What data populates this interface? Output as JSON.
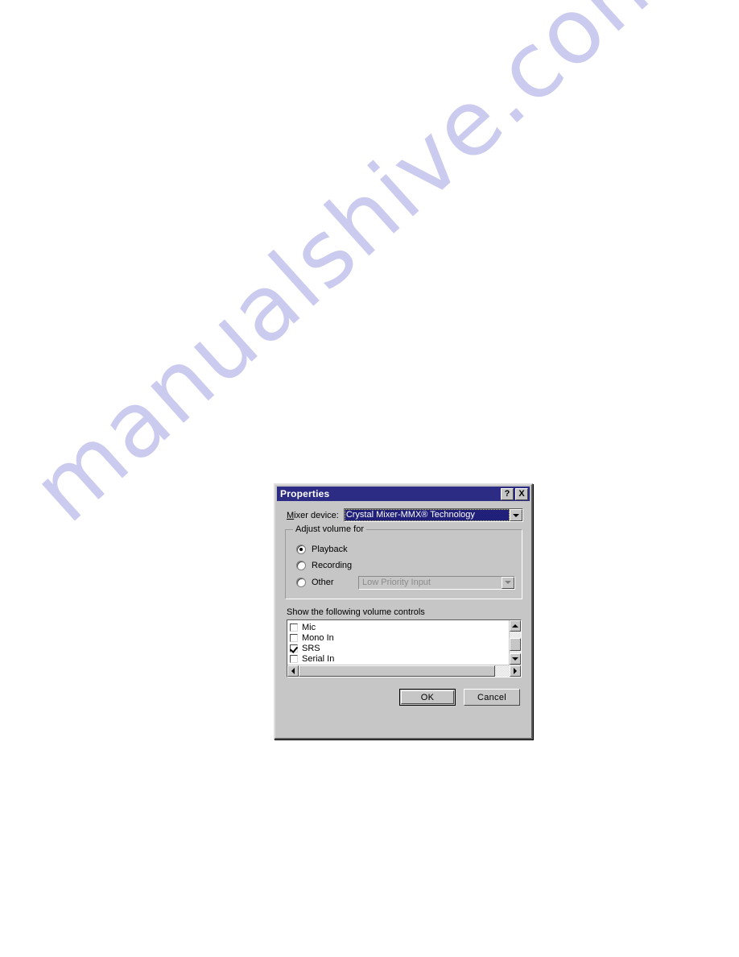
{
  "page": {
    "background_color": "#ffffff",
    "watermark_text": "manualshive.com",
    "watermark_color": "#c9c9ef"
  },
  "dialog": {
    "title": "Properties",
    "titlebar_color": "#2c2c84",
    "face_color": "#c6c6c6",
    "help_button_label": "?",
    "close_button_label": "X",
    "mixer_device": {
      "label": "Mixer device:",
      "label_accel": "M",
      "label_rest": "ixer device:",
      "selected_value": "Crystal Mixer-MMX® Technology",
      "selected_bg": "#20207a",
      "dropdown_icon": "chevron-down-icon"
    },
    "adjust_group": {
      "legend": "Adjust volume for",
      "options": [
        {
          "label": "Playback",
          "checked": true
        },
        {
          "label": "Recording",
          "checked": false
        },
        {
          "label": "Other",
          "checked": false
        }
      ],
      "other_combo": {
        "value": "Low Priority Input",
        "disabled": true,
        "dropdown_icon": "chevron-down-icon"
      }
    },
    "controls_section": {
      "label": "Show the following volume controls",
      "items": [
        {
          "label": "Mic",
          "checked": false
        },
        {
          "label": "Mono In",
          "checked": false
        },
        {
          "label": "SRS",
          "checked": true
        },
        {
          "label": "Serial In",
          "checked": false
        }
      ],
      "vscroll": {
        "up_icon": "scroll-up-arrow-icon",
        "down_icon": "scroll-down-arrow-icon"
      },
      "hscroll": {
        "left_icon": "scroll-left-arrow-icon",
        "right_icon": "scroll-right-arrow-icon"
      }
    },
    "buttons": {
      "ok": "OK",
      "cancel": "Cancel"
    }
  }
}
